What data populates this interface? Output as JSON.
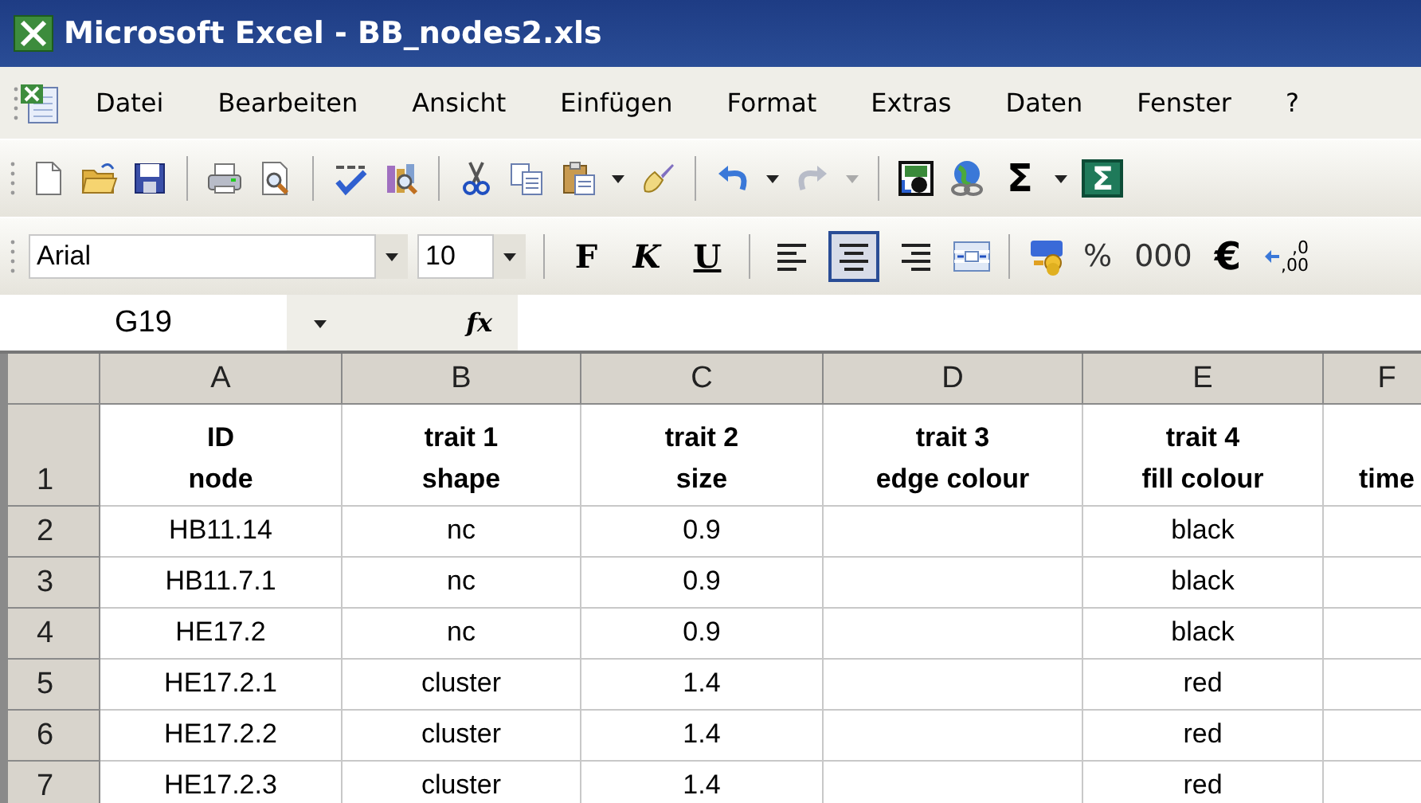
{
  "window": {
    "title": "Microsoft Excel - BB_nodes2.xls"
  },
  "menu": [
    "Datei",
    "Bearbeiten",
    "Ansicht",
    "Einfügen",
    "Format",
    "Extras",
    "Daten",
    "Fenster",
    "?"
  ],
  "standard_toolbar": {
    "undo": {
      "disabled": false
    },
    "redo": {
      "disabled": true
    },
    "sum_buttons": [
      {
        "label": "Σ",
        "kind": "plain"
      },
      {
        "label": "Σ",
        "kind": "boxed"
      }
    ]
  },
  "formatting_toolbar": {
    "font": "Arial",
    "size": "10",
    "style_buttons": [
      {
        "label": "F",
        "kind": "bold",
        "selected": false
      },
      {
        "label": "K",
        "kind": "italic",
        "selected": false
      },
      {
        "label": "U",
        "kind": "underline",
        "selected": false
      }
    ],
    "align_buttons": [
      {
        "kind": "left",
        "selected": false
      },
      {
        "kind": "center",
        "selected": true
      },
      {
        "kind": "right",
        "selected": false
      }
    ],
    "number_buttons": [
      {
        "label": "%",
        "kind": "plain"
      },
      {
        "label": "000",
        "kind": "plain"
      },
      {
        "label": "€",
        "kind": "bold"
      },
      {
        "label": ",0\n,00",
        "kind": "decimal"
      }
    ]
  },
  "formula_bar": {
    "name_box": "G19",
    "function_label": "fx"
  },
  "sheet": {
    "columns": [
      "A",
      "B",
      "C",
      "D",
      "E",
      "F"
    ],
    "rows": [
      {
        "number": "1",
        "kind": "header",
        "cells": [
          "ID\nnode",
          "trait 1\nshape",
          "trait 2\nsize",
          "trait 3\nedge colour",
          "trait 4\nfill colour",
          "time"
        ]
      },
      {
        "number": "2",
        "kind": "data",
        "cells": [
          "HB11.14",
          "nc",
          "0.9",
          null,
          "black",
          null
        ]
      },
      {
        "number": "3",
        "kind": "data",
        "cells": [
          "HB11.7.1",
          "nc",
          "0.9",
          null,
          "black",
          null
        ]
      },
      {
        "number": "4",
        "kind": "data",
        "cells": [
          "HE17.2",
          "nc",
          "0.9",
          null,
          "black",
          null
        ]
      },
      {
        "number": "5",
        "kind": "data",
        "cells": [
          "HE17.2.1",
          "cluster",
          "1.4",
          null,
          "red",
          null
        ]
      },
      {
        "number": "6",
        "kind": "data",
        "cells": [
          "HE17.2.2",
          "cluster",
          "1.4",
          null,
          "red",
          null
        ]
      },
      {
        "number": "7",
        "kind": "data",
        "cells": [
          "HE17.2.3",
          "cluster",
          "1.4",
          null,
          "red",
          null
        ]
      }
    ]
  }
}
